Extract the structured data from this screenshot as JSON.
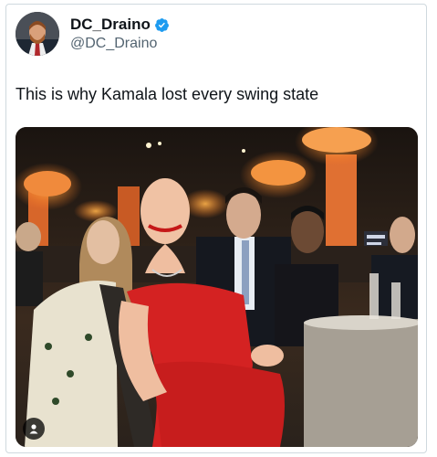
{
  "author": {
    "display_name": "DC_Draino",
    "handle": "@DC_Draino",
    "verified": true,
    "verified_color": "#1d9bf0"
  },
  "tweet": {
    "text": "This is why Kamala lost every swing state"
  },
  "icons": {
    "verified": "verified-badge-icon",
    "media_tag": "person-tag-icon"
  },
  "colors": {
    "text_primary": "#0f1419",
    "text_secondary": "#536471",
    "border": "#cfd9de"
  }
}
